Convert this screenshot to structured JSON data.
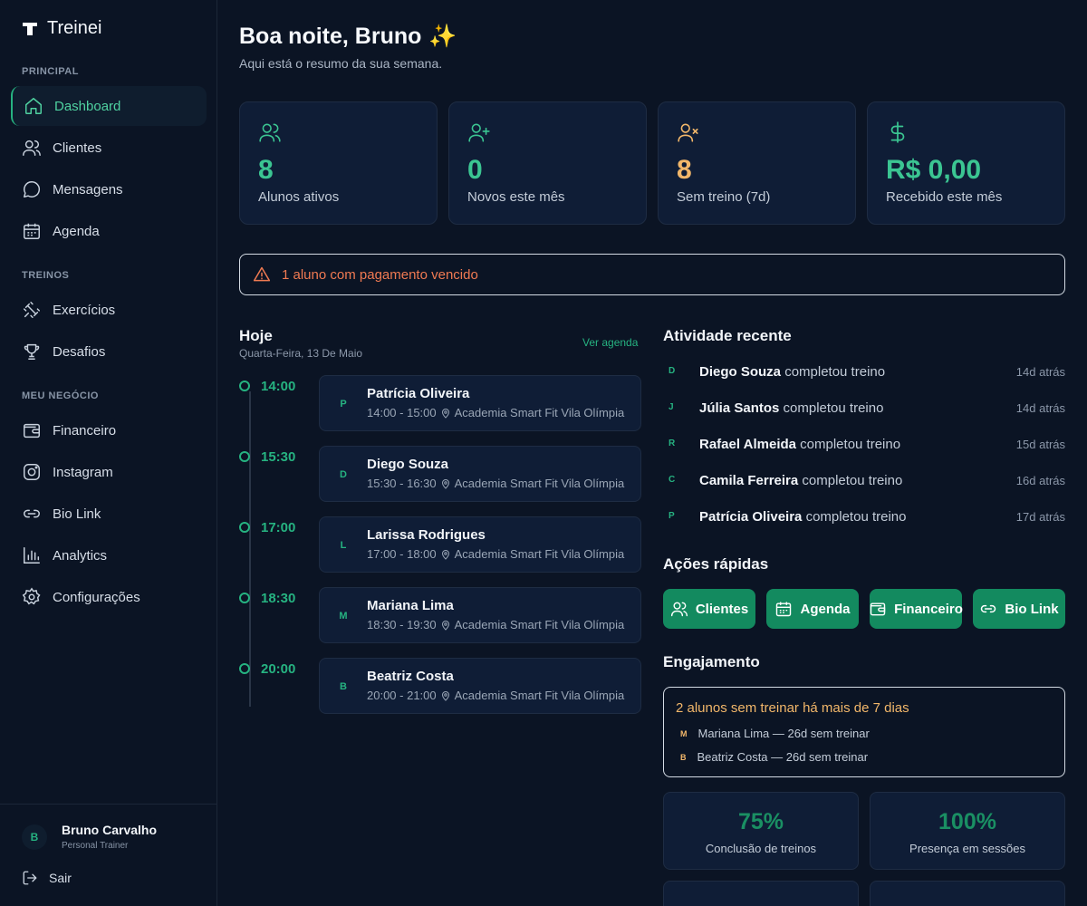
{
  "app": {
    "name": "Treinei"
  },
  "sidebar": {
    "sections": [
      {
        "title": "PRINCIPAL"
      },
      {
        "title": "TREINOS"
      },
      {
        "title": "MEU NEGÓCIO"
      }
    ],
    "items": [
      {
        "label": "Dashboard",
        "icon": "home-icon",
        "active": true
      },
      {
        "label": "Clientes",
        "icon": "users-icon"
      },
      {
        "label": "Mensagens",
        "icon": "message-icon"
      },
      {
        "label": "Agenda",
        "icon": "calendar-icon"
      },
      {
        "label": "Exercícios",
        "icon": "dumbbell-icon"
      },
      {
        "label": "Desafios",
        "icon": "trophy-icon"
      },
      {
        "label": "Financeiro",
        "icon": "wallet-icon"
      },
      {
        "label": "Instagram",
        "icon": "instagram-icon"
      },
      {
        "label": "Bio Link",
        "icon": "link-icon"
      },
      {
        "label": "Analytics",
        "icon": "bar-chart-icon"
      },
      {
        "label": "Configurações",
        "icon": "gear-icon"
      }
    ],
    "user": {
      "initial": "B",
      "name": "Bruno Carvalho",
      "role": "Personal Trainer"
    },
    "logout_label": "Sair"
  },
  "header": {
    "greeting": "Boa noite, Bruno",
    "emoji": "✨",
    "subtitle": "Aqui está o resumo da sua semana."
  },
  "stats": [
    {
      "value": "8",
      "label": "Alunos ativos",
      "icon": "users-icon",
      "color": "#3bc592"
    },
    {
      "value": "0",
      "label": "Novos este mês",
      "icon": "user-plus-icon",
      "color": "#3bc592"
    },
    {
      "value": "8",
      "label": "Sem treino (7d)",
      "icon": "user-x-icon",
      "color": "#f2b76a"
    },
    {
      "value": "R$ 0,00",
      "label": "Recebido este mês",
      "icon": "dollar-icon",
      "color": "#3bc592"
    }
  ],
  "alert": {
    "text": "1 aluno com pagamento vencido",
    "color": "#f07a52"
  },
  "today": {
    "title": "Hoje",
    "date": "Quarta-Feira, 13 De Maio",
    "see_agenda": "Ver agenda",
    "appointments": [
      {
        "time": "14:00",
        "initial": "P",
        "name": "Patrícia Oliveira",
        "range": "14:00 - 15:00",
        "location": "Academia Smart Fit Vila Olímpia"
      },
      {
        "time": "15:30",
        "initial": "D",
        "name": "Diego Souza",
        "range": "15:30 - 16:30",
        "location": "Academia Smart Fit Vila Olímpia"
      },
      {
        "time": "17:00",
        "initial": "L",
        "name": "Larissa Rodrigues",
        "range": "17:00 - 18:00",
        "location": "Academia Smart Fit Vila Olímpia"
      },
      {
        "time": "18:30",
        "initial": "M",
        "name": "Mariana Lima",
        "range": "18:30 - 19:30",
        "location": "Academia Smart Fit Vila Olímpia"
      },
      {
        "time": "20:00",
        "initial": "B",
        "name": "Beatriz Costa",
        "range": "20:00 - 21:00",
        "location": "Academia Smart Fit Vila Olímpia"
      }
    ]
  },
  "activity": {
    "title": "Atividade recente",
    "items": [
      {
        "initial": "D",
        "name": "Diego Souza",
        "action": "completou treino",
        "time": "14d atrás"
      },
      {
        "initial": "J",
        "name": "Júlia Santos",
        "action": "completou treino",
        "time": "14d atrás"
      },
      {
        "initial": "R",
        "name": "Rafael Almeida",
        "action": "completou treino",
        "time": "15d atrás"
      },
      {
        "initial": "C",
        "name": "Camila Ferreira",
        "action": "completou treino",
        "time": "16d atrás"
      },
      {
        "initial": "P",
        "name": "Patrícia Oliveira",
        "action": "completou treino",
        "time": "17d atrás"
      }
    ]
  },
  "quick_actions": {
    "title": "Ações rápidas",
    "buttons": [
      {
        "label": "Clientes",
        "icon": "users-icon"
      },
      {
        "label": "Agenda",
        "icon": "calendar-icon"
      },
      {
        "label": "Financeiro",
        "icon": "wallet-icon"
      },
      {
        "label": "Bio Link",
        "icon": "link-icon"
      }
    ]
  },
  "engagement": {
    "title": "Engajamento",
    "warning": "2 alunos sem treinar há mais de 7 dias",
    "items": [
      {
        "initial": "M",
        "text": "Mariana Lima — 26d sem treinar"
      },
      {
        "initial": "B",
        "text": "Beatriz Costa — 26d sem treinar"
      }
    ],
    "metrics": [
      {
        "value": "75%",
        "label": "Conclusão de treinos"
      },
      {
        "value": "100%",
        "label": "Presença em sessões"
      }
    ]
  },
  "colors": {
    "accent": "#26b381",
    "warning": "#f2b76a",
    "danger": "#f07a52",
    "background": "#0b1424",
    "card": "#0f1d36"
  }
}
